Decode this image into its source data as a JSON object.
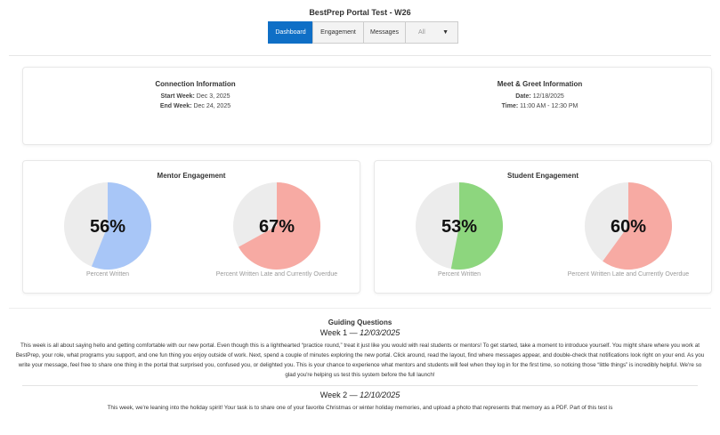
{
  "header": {
    "app_title": "BestPrep Portal Test - W26",
    "tabs": [
      "Dashboard",
      "Engagement",
      "Messages"
    ],
    "active_tab": "Dashboard",
    "filter_value": "All"
  },
  "connection": {
    "title": "Connection Information",
    "start_label": "Start Week:",
    "start_value": "Dec 3, 2025",
    "end_label": "End Week:",
    "end_value": "Dec 24, 2025"
  },
  "meet_greet": {
    "title": "Meet & Greet Information",
    "date_label": "Date:",
    "date_value": "12/18/2025",
    "time_label": "Time:",
    "time_value": "11:00 AM - 12:30 PM"
  },
  "mentor_engagement": {
    "title": "Mentor Engagement",
    "charts": [
      {
        "percent": 56,
        "label": "56%",
        "caption": "Percent Written",
        "color": "#a8c6f7"
      },
      {
        "percent": 67,
        "label": "67%",
        "caption": "Percent Written Late and Currently Overdue",
        "color": "#f7aaa3"
      }
    ]
  },
  "student_engagement": {
    "title": "Student Engagement",
    "charts": [
      {
        "percent": 53,
        "label": "53%",
        "caption": "Percent Written",
        "color": "#8dd67e"
      },
      {
        "percent": 60,
        "label": "60%",
        "caption": "Percent Written Late and Currently Overdue",
        "color": "#f7aaa3"
      }
    ]
  },
  "colors": {
    "pie_rest": "#ececec",
    "accent": "#0f6fc6"
  },
  "guiding": {
    "title": "Guiding Questions",
    "week1_label": "Week 1 — ",
    "week1_date": "12/03/2025",
    "week1_body": "This week is all about saying hello and getting comfortable with our new portal. Even though this is a lighthearted “practice round,” treat it just like you would with real students or mentors! To get started, take a moment to introduce yourself. You might share where you work at BestPrep, your role, what programs you support, and one fun thing you enjoy outside of work. Next, spend a couple of minutes exploring the new portal. Click around, read the layout, find where messages appear, and double-check that notifications look right on your end. As you write your message, feel free to share one thing in the portal that surprised you, confused you, or delighted you. This is your chance to experience what mentors and students will feel when they log in for the first time, so noticing those “little things” is incredibly helpful. We're so glad you're helping us test this system before the full launch!",
    "week2_label": "Week 2 — ",
    "week2_date": "12/10/2025",
    "week2_body": "This week, we're leaning into the holiday spirit! Your task is to share one of your favorite Christmas or winter holiday memories, and upload a photo that represents that memory as a PDF. Part of this test is"
  }
}
